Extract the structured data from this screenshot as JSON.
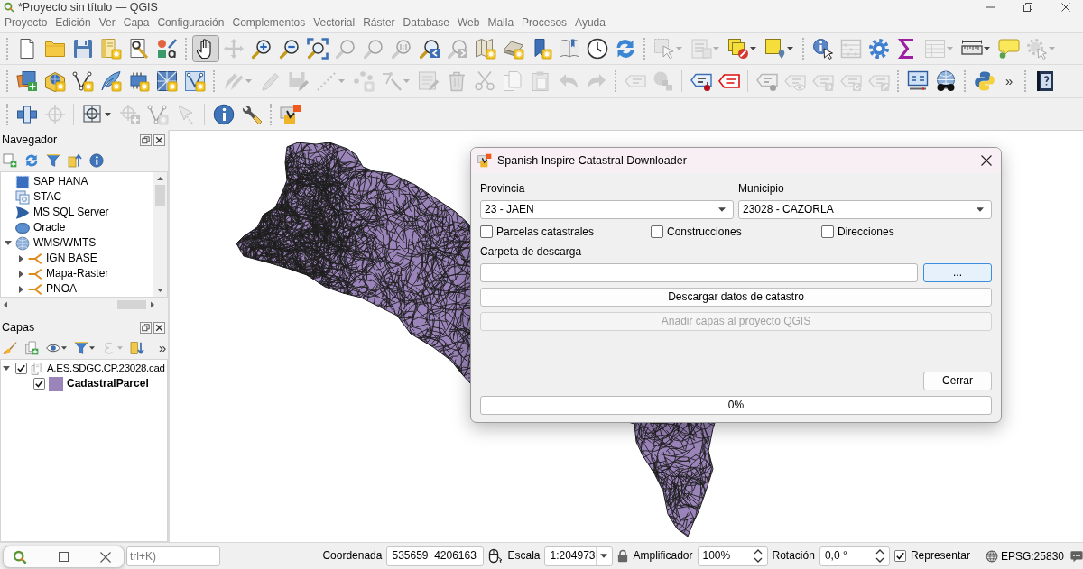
{
  "window": {
    "title": "*Proyecto sin título — QGIS"
  },
  "menu": [
    "Proyecto",
    "Edición",
    "Ver",
    "Capa",
    "Configuración",
    "Complementos",
    "Vectorial",
    "Ráster",
    "Database",
    "Web",
    "Malla",
    "Procesos",
    "Ayuda"
  ],
  "toolbar_rows": [
    {
      "toolbars": [
        {
          "items": [
            {
              "kind": "tool",
              "disabled": false,
              "checked": false
            },
            {
              "kind": "tool",
              "disabled": false,
              "checked": false
            },
            {
              "kind": "tool",
              "disabled": false,
              "checked": false
            },
            {
              "kind": "tool",
              "disabled": false,
              "checked": false
            },
            {
              "kind": "tool",
              "disabled": false,
              "checked": false
            },
            {
              "kind": "tool",
              "disabled": false,
              "checked": false
            }
          ]
        },
        {
          "items": [
            {
              "kind": "tool",
              "disabled": false,
              "checked": true
            },
            {
              "kind": "tool",
              "disabled": true,
              "checked": false
            },
            {
              "kind": "tool",
              "disabled": false,
              "checked": false
            },
            {
              "kind": "tool",
              "disabled": false,
              "checked": false
            },
            {
              "kind": "tool",
              "disabled": false,
              "checked": false
            },
            {
              "kind": "tool",
              "disabled": true,
              "checked": false
            },
            {
              "kind": "tool",
              "disabled": true,
              "checked": false
            },
            {
              "kind": "tool",
              "disabled": true,
              "checked": false
            },
            {
              "kind": "tool",
              "disabled": false,
              "checked": false
            },
            {
              "kind": "tool",
              "disabled": true,
              "checked": false
            },
            {
              "kind": "tool",
              "disabled": false,
              "checked": false
            },
            {
              "kind": "tool",
              "disabled": false,
              "checked": false
            },
            {
              "kind": "tool",
              "disabled": false,
              "checked": false
            },
            {
              "kind": "tool",
              "disabled": false,
              "checked": false
            },
            {
              "kind": "tool",
              "disabled": false,
              "checked": false
            },
            {
              "kind": "tool",
              "disabled": false,
              "checked": false
            }
          ]
        },
        {
          "items": [
            {
              "kind": "tool",
              "disabled": true,
              "checked": false,
              "dropdown": true
            },
            {
              "kind": "tool",
              "disabled": true,
              "checked": false,
              "dropdown": true
            },
            {
              "kind": "tool",
              "disabled": false,
              "checked": false,
              "dropdown": true
            },
            {
              "kind": "tool",
              "disabled": false,
              "checked": false,
              "dropdown": true
            }
          ]
        },
        {
          "items": [
            {
              "kind": "tool",
              "disabled": false,
              "checked": false
            },
            {
              "kind": "tool",
              "disabled": true,
              "checked": false
            },
            {
              "kind": "tool",
              "disabled": false,
              "checked": false
            },
            {
              "kind": "tool",
              "disabled": false,
              "checked": false
            },
            {
              "kind": "tool",
              "disabled": true,
              "checked": false,
              "dropdown": true
            },
            {
              "kind": "tool",
              "disabled": false,
              "checked": false,
              "dropdown": true
            },
            {
              "kind": "tool",
              "disabled": false,
              "checked": false
            },
            {
              "kind": "tool",
              "disabled": true,
              "checked": false,
              "dropdown": true
            }
          ]
        }
      ]
    },
    {
      "toolbars": [
        {
          "items": [
            {
              "kind": "tool",
              "disabled": false,
              "checked": false
            },
            {
              "kind": "tool",
              "disabled": false,
              "checked": false
            },
            {
              "kind": "tool",
              "disabled": false,
              "checked": false
            },
            {
              "kind": "tool",
              "disabled": false,
              "checked": false
            },
            {
              "kind": "tool",
              "disabled": false,
              "checked": false
            },
            {
              "kind": "tool",
              "disabled": false,
              "checked": false
            },
            {
              "kind": "tool",
              "disabled": false,
              "checked": false
            }
          ]
        },
        {
          "items": [
            {
              "kind": "tool",
              "disabled": true,
              "checked": false,
              "dropdown": true
            },
            {
              "kind": "tool",
              "disabled": true,
              "checked": false
            },
            {
              "kind": "tool",
              "disabled": true,
              "checked": false
            },
            {
              "kind": "tool",
              "disabled": true,
              "checked": false,
              "dropdown": true
            },
            {
              "kind": "tool",
              "disabled": true,
              "checked": false
            },
            {
              "kind": "tool",
              "disabled": true,
              "checked": false,
              "dropdown": true
            },
            {
              "kind": "tool",
              "disabled": true,
              "checked": false
            },
            {
              "kind": "tool",
              "disabled": true,
              "checked": false
            },
            {
              "kind": "tool",
              "disabled": true,
              "checked": false
            },
            {
              "kind": "tool",
              "disabled": true,
              "checked": false
            },
            {
              "kind": "tool",
              "disabled": true,
              "checked": false
            },
            {
              "kind": "tool",
              "disabled": true,
              "checked": false
            },
            {
              "kind": "tool",
              "disabled": true,
              "checked": false
            }
          ]
        },
        {
          "items": [
            {
              "kind": "tool",
              "disabled": true,
              "checked": false
            },
            {
              "kind": "tool",
              "disabled": true,
              "checked": false
            },
            {
              "kind": "separator"
            },
            {
              "kind": "tool",
              "disabled": false,
              "checked": false
            },
            {
              "kind": "tool",
              "disabled": false,
              "checked": false
            },
            {
              "kind": "separator"
            },
            {
              "kind": "tool",
              "disabled": true,
              "checked": false
            },
            {
              "kind": "tool",
              "disabled": true,
              "checked": false
            },
            {
              "kind": "tool",
              "disabled": true,
              "checked": false
            },
            {
              "kind": "tool",
              "disabled": true,
              "checked": false
            },
            {
              "kind": "tool",
              "disabled": true,
              "checked": false
            }
          ]
        },
        {
          "items": [
            {
              "kind": "tool",
              "disabled": false,
              "checked": false
            },
            {
              "kind": "tool",
              "disabled": false,
              "checked": false
            }
          ]
        },
        {
          "items": [
            {
              "kind": "tool",
              "disabled": false,
              "checked": false
            },
            {
              "kind": "overflow",
              "text": "»"
            }
          ]
        },
        {
          "items": [
            {
              "kind": "tool",
              "disabled": false,
              "checked": false
            }
          ]
        }
      ]
    },
    {
      "toolbars": [
        {
          "items": [
            {
              "kind": "tool",
              "disabled": false,
              "checked": false
            },
            {
              "kind": "tool",
              "disabled": true,
              "checked": false
            },
            {
              "kind": "separator"
            },
            {
              "kind": "tool",
              "disabled": false,
              "checked": false,
              "dropdown": true
            },
            {
              "kind": "tool",
              "disabled": true,
              "checked": false
            },
            {
              "kind": "tool",
              "disabled": true,
              "checked": false
            },
            {
              "kind": "tool",
              "disabled": true,
              "checked": false
            },
            {
              "kind": "separator"
            },
            {
              "kind": "tool",
              "disabled": false,
              "checked": false
            },
            {
              "kind": "tool",
              "disabled": false,
              "checked": false
            }
          ]
        },
        {
          "items": [
            {
              "kind": "tool",
              "disabled": false,
              "checked": false
            }
          ]
        }
      ]
    }
  ],
  "browser_panel": {
    "title": "Navegador",
    "tools": [
      {
        "disabled": false
      },
      {
        "disabled": false
      },
      {
        "disabled": false
      },
      {
        "disabled": false
      },
      {
        "disabled": false
      }
    ],
    "items": [
      {
        "label": "SAP HANA"
      },
      {
        "label": "STAC"
      },
      {
        "label": "MS SQL Server"
      },
      {
        "label": "Oracle"
      },
      {
        "label": "WMS/WMTS",
        "expanded": true,
        "children": [
          {
            "label": "IGN BASE",
            "expanded": false
          },
          {
            "label": "Mapa-Raster",
            "expanded": false
          },
          {
            "label": "PNOA",
            "expanded": false
          }
        ]
      }
    ]
  },
  "layers_panel": {
    "title": "Capas",
    "tools": [
      {
        "disabled": false
      },
      {
        "disabled": false
      },
      {
        "disabled": false,
        "dropdown": true
      },
      {
        "disabled": false,
        "dropdown": true
      },
      {
        "disabled": true,
        "dropdown": true
      },
      {
        "disabled": false
      }
    ],
    "overflow": "»",
    "items": [
      {
        "kind": "group",
        "label": "A.ES.SDGC.CP.23028.cad",
        "checked": true,
        "expanded": true,
        "children": [
          {
            "kind": "layer",
            "label": "CadastralParcel",
            "checked": true,
            "color": "#9a84b9"
          }
        ]
      }
    ]
  },
  "dialog": {
    "title": "Spanish Inspire Catastral Downloader",
    "selects": [
      {
        "label": "Provincia",
        "value": "23 - JAEN"
      },
      {
        "label": "Municipio",
        "value": "23028 - CAZORLA"
      }
    ],
    "options": [
      {
        "label": "Parcelas catastrales",
        "checked": false
      },
      {
        "label": "Construcciones",
        "checked": false
      },
      {
        "label": "Direcciones",
        "checked": false
      }
    ],
    "folder": {
      "label": "Carpeta de descarga"
    },
    "browse": {
      "label": "...",
      "focused": true
    },
    "actions": [
      {
        "label": "Descargar datos de catastro",
        "disabled": false
      },
      {
        "label": "Añadir capas al proyecto QGIS",
        "disabled": true
      }
    ],
    "close": {
      "label": "Cerrar"
    },
    "progress": {
      "level": 0,
      "reading": "0%"
    }
  },
  "status_bar": {
    "locator": {
      "placeholder": "trl+K)"
    },
    "coordinate": {
      "label": "Coordenada",
      "value": "535659  4206163"
    },
    "scale": {
      "label": "Escala",
      "value": "1:204973"
    },
    "magnifier": {
      "label": "Amplificador",
      "value": "100%"
    },
    "rotation": {
      "label": "Rotación",
      "value": "0,0 °"
    },
    "render": {
      "label": "Representar",
      "checked": true
    },
    "crs": "EPSG:25830"
  }
}
